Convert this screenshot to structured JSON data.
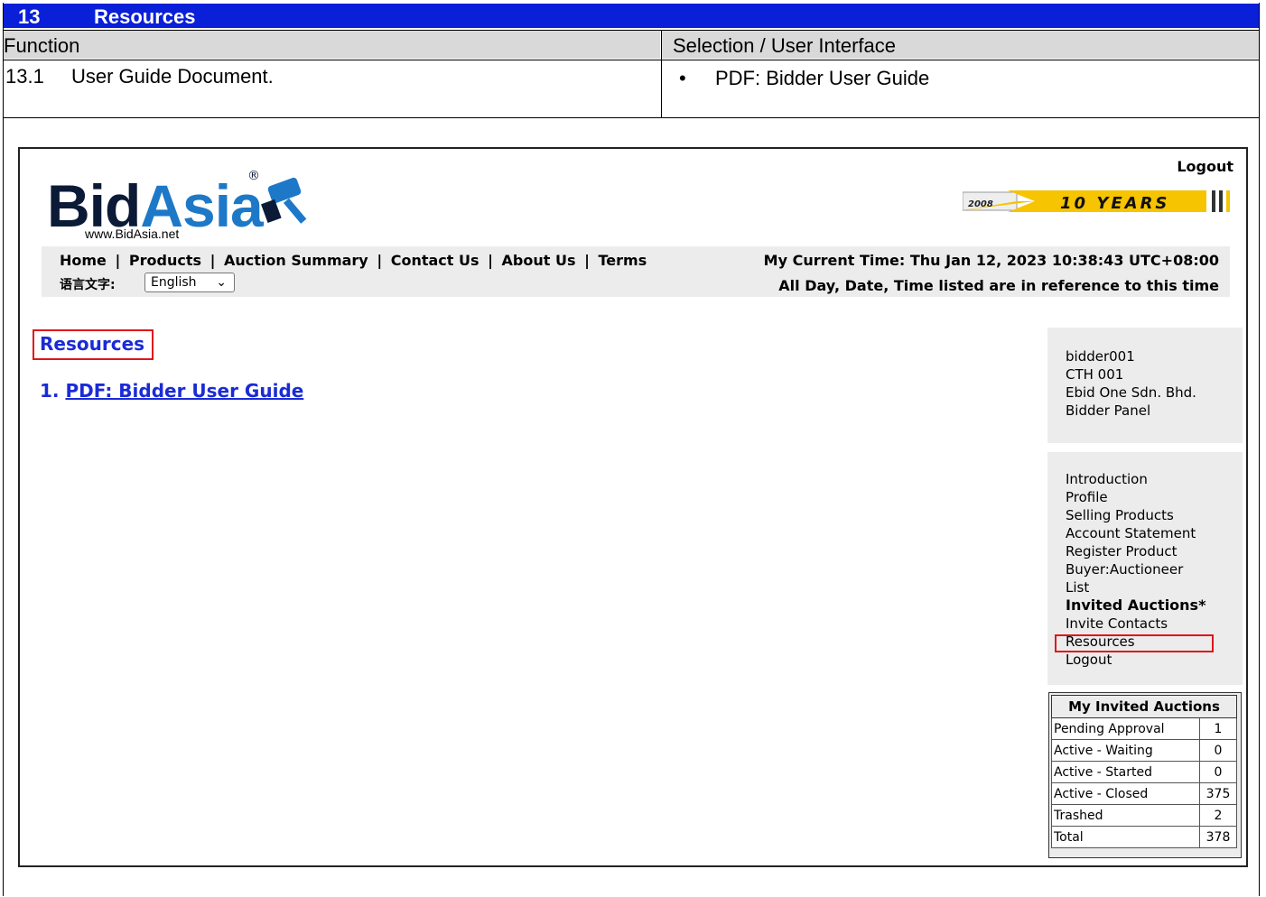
{
  "doc": {
    "section_number": "13",
    "section_title": "Resources",
    "col_function": "Function",
    "col_selection": "Selection / User Interface",
    "row_number": "13.1",
    "row_function": "User Guide Document.",
    "row_selection_bullet": "•",
    "row_selection": "PDF: Bidder User Guide"
  },
  "site": {
    "logo_dark": "Bid",
    "logo_light": "Asia",
    "logo_reg": "®",
    "logo_url": "www.BidAsia.net",
    "logout": "Logout",
    "banner_year": "2008",
    "banner_text": "10 YEARS"
  },
  "nav": {
    "links": [
      "Home",
      "Products",
      "Auction Summary",
      "Contact Us",
      "About Us",
      "Terms"
    ],
    "separator": "|",
    "lang_label": "语言文字:",
    "lang_value": "English",
    "current_time": "My Current Time: Thu Jan 12, 2023 10:38:43 UTC+08:00",
    "time_note": "All Day, Date, Time listed are in reference to this time"
  },
  "main": {
    "title": "Resources",
    "link_number": "1.",
    "link_label": "PDF: Bidder User Guide"
  },
  "user_panel": {
    "lines": [
      "bidder001",
      "CTH 001",
      "Ebid One Sdn. Bhd.",
      "Bidder Panel"
    ]
  },
  "menu": {
    "items": [
      "Introduction",
      "Profile",
      "Selling Products",
      "Account Statement",
      "Register Product",
      "Buyer:Auctioneer List",
      "Invited Auctions*",
      "Invite Contacts",
      "Resources",
      "Logout"
    ]
  },
  "invited_auctions": {
    "title": "My Invited Auctions",
    "rows": [
      {
        "label": "Pending Approval",
        "value": "1"
      },
      {
        "label": "Active - Waiting",
        "value": "0"
      },
      {
        "label": "Active - Started",
        "value": "0"
      },
      {
        "label": "Active - Closed",
        "value": "375"
      },
      {
        "label": "Trashed",
        "value": "2"
      },
      {
        "label": "Total",
        "value": "378"
      }
    ]
  },
  "colors": {
    "section_header": "#0a1fd8",
    "link_blue": "#1a2bd6",
    "highlight_red": "#e0151b",
    "panel_gray": "#ececec"
  }
}
